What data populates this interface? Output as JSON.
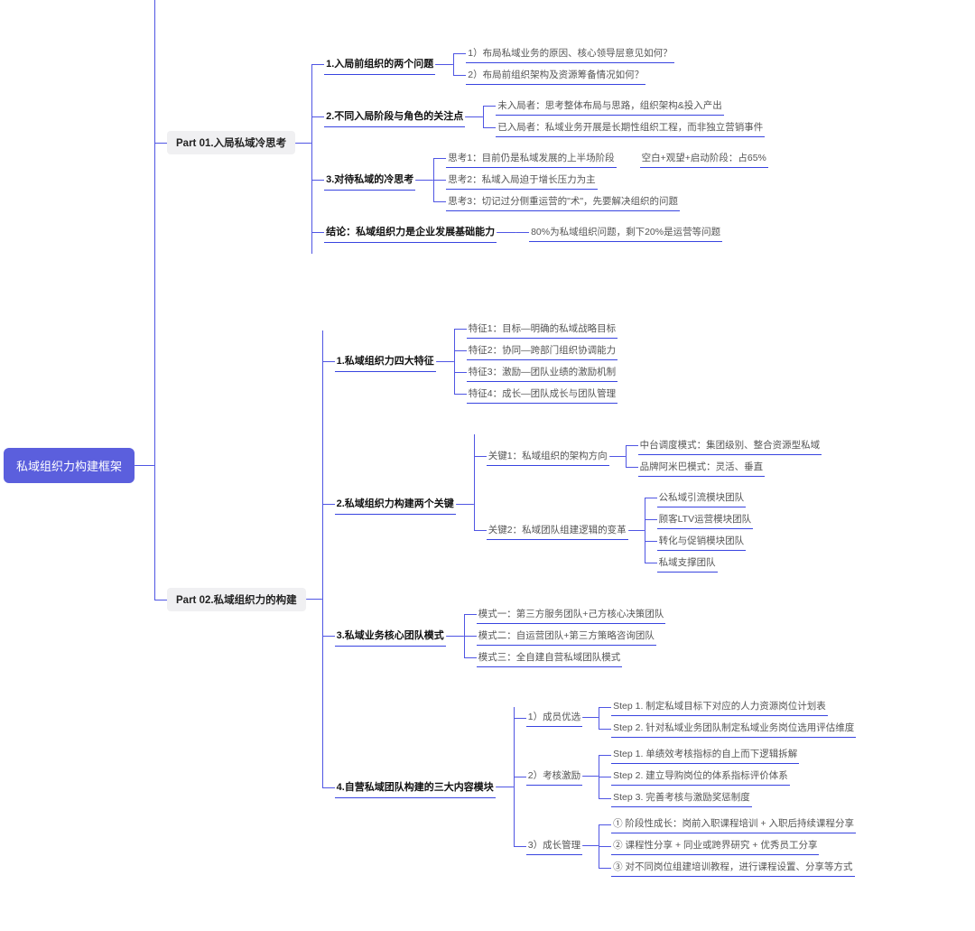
{
  "root": "私域组织力构建框架",
  "p1": {
    "title": "Part 01.入局私域冷思考",
    "s1": {
      "title": "1.入局前组织的两个问题",
      "a": "1）布局私域业务的原因、核心领导层意见如何？",
      "b": "2）布局前组织架构及资源筹备情况如何？"
    },
    "s2": {
      "title": "2.不同入局阶段与角色的关注点",
      "a": "未入局者：思考整体布局与思路，组织架构&投入产出",
      "b": "已入局者：私域业务开展是长期性组织工程，而非独立营销事件"
    },
    "s3": {
      "title": "3.对待私域的冷思考",
      "a": "思考1：目前仍是私域发展的上半场阶段",
      "a_extra": "空白+观望+启动阶段：占65%",
      "b": "思考2：私域入局迫于增长压力为主",
      "c": "思考3：切记过分侧重运营的\"术\"，先要解决组织的问题"
    },
    "s4": {
      "title": "结论：私域组织力是企业发展基础能力",
      "a": "80%为私域组织问题，剩下20%是运营等问题"
    }
  },
  "p2": {
    "title": "Part 02.私域组织力的构建",
    "s1": {
      "title": "1.私域组织力四大特征",
      "a": "特征1：目标—明确的私域战略目标",
      "b": "特征2：协同—跨部门组织协调能力",
      "c": "特征3：激励—团队业绩的激励机制",
      "d": "特征4：成长—团队成长与团队管理"
    },
    "s2": {
      "title": "2.私域组织力构建两个关键",
      "k1": {
        "title": "关键1：私域组织的架构方向",
        "a": "中台调度模式：集团级别、整合资源型私域",
        "b": "品牌阿米巴模式：灵活、垂直"
      },
      "k2": {
        "title": "关键2：私域团队组建逻辑的变革",
        "a": "公私域引流模块团队",
        "b": "顾客LTV运营模块团队",
        "c": "转化与促销模块团队",
        "d": "私域支撑团队"
      }
    },
    "s3": {
      "title": "3.私域业务核心团队模式",
      "a": "模式一：第三方服务团队+己方核心决策团队",
      "b": "模式二：自运营团队+第三方策略咨询团队",
      "c": "模式三：全自建自营私域团队模式"
    },
    "s4": {
      "title": "4.自营私域团队构建的三大内容模块",
      "m1": {
        "title": "1）成员优选",
        "a": "Step 1. 制定私域目标下对应的人力资源岗位计划表",
        "b": "Step 2. 针对私域业务团队制定私域业务岗位选用评估维度"
      },
      "m2": {
        "title": "2）考核激励",
        "a": "Step 1. 单绩效考核指标的自上而下逻辑拆解",
        "b": "Step 2. 建立导购岗位的体系指标评价体系",
        "c": "Step 3. 完善考核与激励奖惩制度"
      },
      "m3": {
        "title": "3）成长管理",
        "a": "① 阶段性成长：岗前入职课程培训 + 入职后持续课程分享",
        "b": "② 课程性分享 + 同业或跨界研究 + 优秀员工分享",
        "c": "③ 对不同岗位组建培训教程，进行课程设置、分享等方式"
      }
    }
  }
}
